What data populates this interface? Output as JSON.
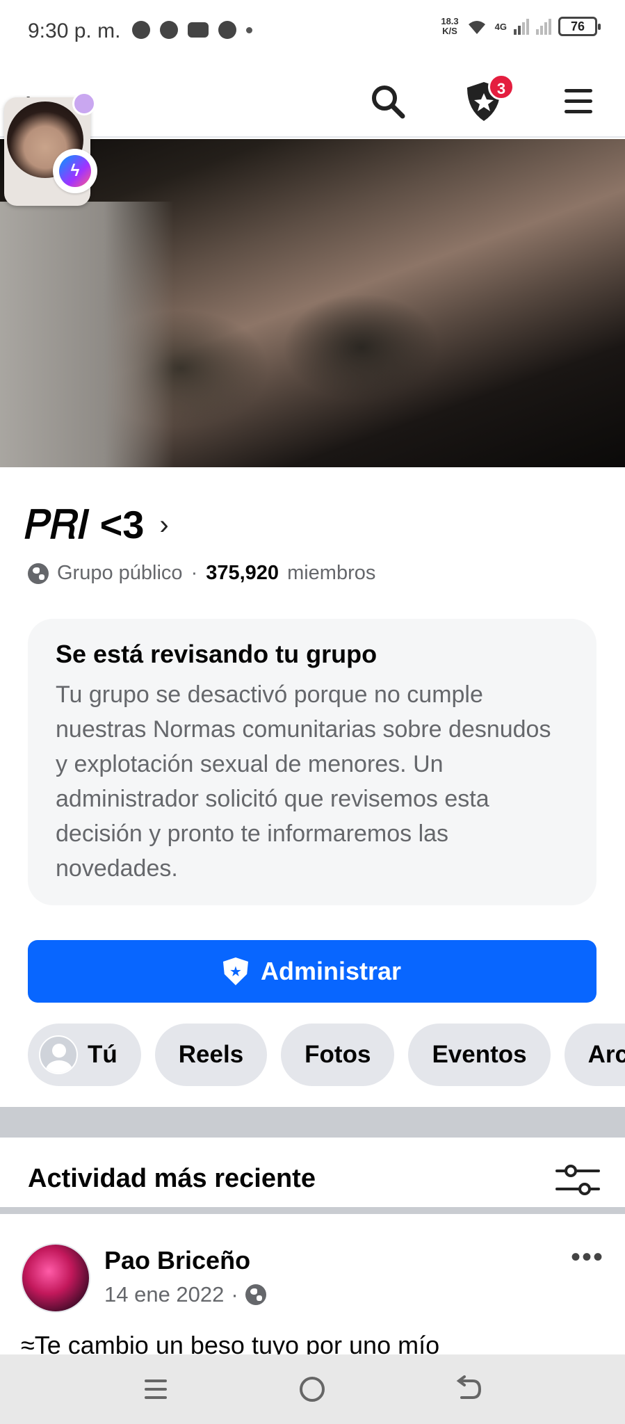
{
  "status_bar": {
    "time": "9:30 p. m.",
    "net_speed_value": "18.3",
    "net_speed_unit": "K/S",
    "network": "4G",
    "battery": "76"
  },
  "app_bar": {
    "notification_count": "3",
    "icons": [
      "back-arrow-icon",
      "search-icon",
      "shield-star-icon",
      "menu-icon"
    ]
  },
  "group": {
    "name": "𝑃𝑅𝐼 <3",
    "privacy": "Grupo público",
    "separator": "·",
    "members_count": "375,920",
    "members_label": "miembros"
  },
  "review_notice": {
    "title": "Se está revisando tu grupo",
    "body": "Tu grupo se desactivó porque no cumple nuestras Normas comunitarias sobre desnudos y explotación sexual de menores. Un administrador solicitó que revisemos esta decisión y pronto te informaremos las novedades."
  },
  "manage_button": {
    "label": "Administrar"
  },
  "chips": [
    {
      "label": "Tú"
    },
    {
      "label": "Reels"
    },
    {
      "label": "Fotos"
    },
    {
      "label": "Eventos"
    },
    {
      "label": "Archi"
    }
  ],
  "feed": {
    "section_title": "Actividad más reciente",
    "post": {
      "author": "Pao Briceño",
      "date": "14 ene 2022",
      "separator": "·",
      "text": "≈Te cambio un beso tuyo por uno mío"
    }
  },
  "colors": {
    "primary": "#0866ff",
    "badge": "#e41e3f",
    "secondary_text": "#65676b",
    "chip_bg": "#e4e6eb"
  }
}
